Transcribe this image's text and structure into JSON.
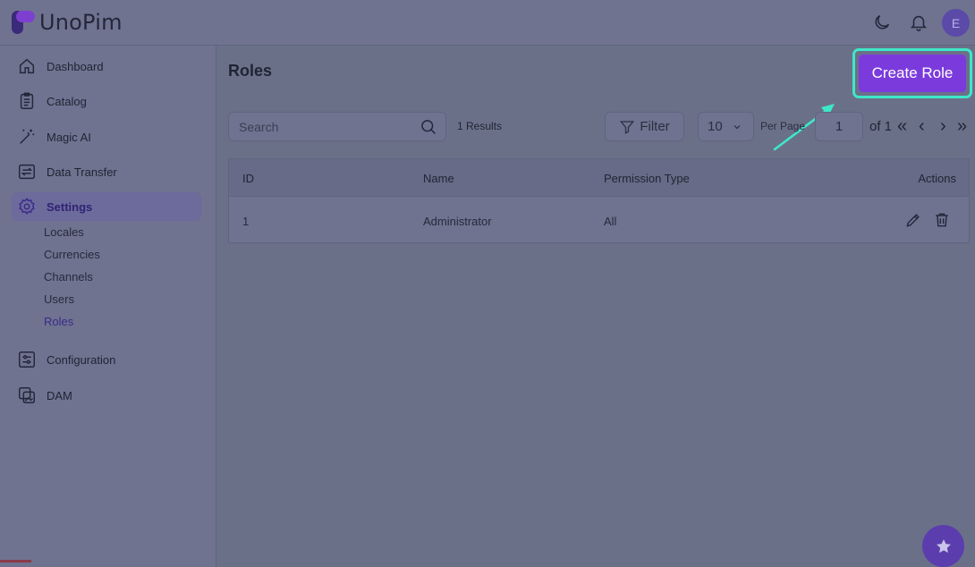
{
  "app": {
    "name": "UnoPim",
    "avatar_initial": "E"
  },
  "sidebar": {
    "items": [
      {
        "label": "Dashboard",
        "icon": "home-icon"
      },
      {
        "label": "Catalog",
        "icon": "clipboard-icon"
      },
      {
        "label": "Magic AI",
        "icon": "magic-wand-icon"
      },
      {
        "label": "Data Transfer",
        "icon": "transfer-icon"
      },
      {
        "label": "Settings",
        "icon": "gear-icon"
      },
      {
        "label": "Configuration",
        "icon": "sliders-icon"
      },
      {
        "label": "DAM",
        "icon": "images-icon"
      }
    ],
    "settings_sub": [
      "Locales",
      "Currencies",
      "Channels",
      "Users",
      "Roles"
    ]
  },
  "main": {
    "title": "Roles",
    "create_button": "Create Role",
    "search_placeholder": "Search",
    "results": "1 Results",
    "filter_label": "Filter",
    "per_page_value": "10",
    "per_page_label": "Per Page",
    "page_value": "1",
    "of_label": "of 1",
    "pager": {
      "first": "«",
      "prev": "‹",
      "next": "›",
      "last": "»"
    }
  },
  "table": {
    "headers": [
      "ID",
      "Name",
      "Permission Type",
      "Actions"
    ],
    "rows": [
      {
        "id": "1",
        "name": "Administrator",
        "permission": "All"
      }
    ]
  },
  "colors": {
    "accent": "#7b3bdc",
    "highlight": "#3de8c8",
    "background": "#6b7089"
  }
}
